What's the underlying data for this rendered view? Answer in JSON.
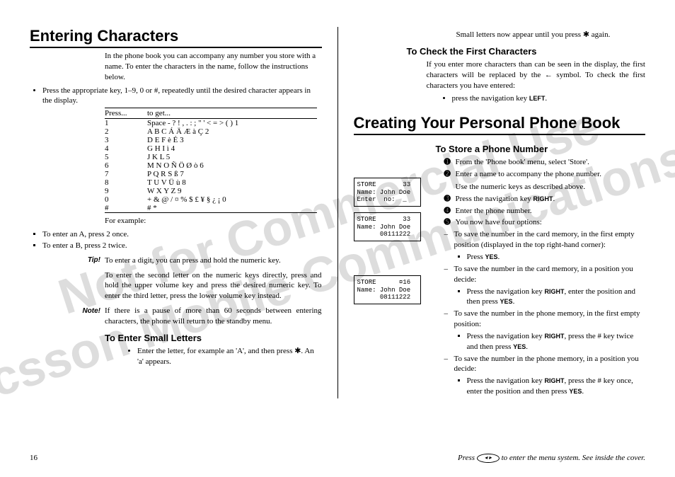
{
  "wm_l1": "Not for Commercial Use",
  "wm_l2": "Ericsson Mobile Communications AB",
  "left": {
    "h1": "Entering Characters",
    "intro": "In the phone book you can accompany any number you store with a name. To enter the characters in the name, follow the instructions below.",
    "bul1": "Press the appropriate key, 1–9, 0 or #, repeatedly until the desired character appears in the display.",
    "th1": "Press...",
    "th2": "to get...",
    "r1a": "1",
    "r1b": "Space  - ? ! , . : ; \" '  < = > ( ) 1",
    "r2a": "2",
    "r2b": "A  B  C  Á  Ä  Æ  à  Ç  2",
    "r3a": "3",
    "r3b": "D  E  F  è  É  3",
    "r4a": "4",
    "r4b": "G  H  I  ì  4",
    "r5a": "5",
    "r5b": "J  K  L  5",
    "r6a": "6",
    "r6b": "M  N  O  Ñ  Ö  Ø  ò  6",
    "r7a": "7",
    "r7b": "P  Q  R  S  ß  7",
    "r8a": "8",
    "r8b": "T  U  V  Ü  ù  8",
    "r9a": "9",
    "r9b": "W  X  Y  Z  9",
    "r10a": "0",
    "r10b": "+  &  @  /  ¤ % $  £  ¥ § ¿ ¡ 0",
    "r11a": "#",
    "r11b": "#  *",
    "forex": "For example:",
    "ex1": "To enter an A, press 2 once.",
    "ex2": "To enter a B, press 2 twice.",
    "tiplabel": "Tip!",
    "tipbody": "To enter a digit, you can press and hold the numeric key.",
    "para2": "To enter the second letter  on the numeric keys directly, press and hold the upper volume key and press the desired numeric key. To enter the third letter, press the lower volume key instead.",
    "notelabel": "Note!",
    "notebody": "If there is a pause of more than 60 seconds between entering characters, the phone will return to the standby menu.",
    "h2small": "To Enter Small Letters",
    "small1": "Enter the letter, for example an 'A', and then press ✱. An 'a' appears."
  },
  "right": {
    "topline": "Small letters now appear until you press ✱ again.",
    "h2check": "To Check the First Characters",
    "checkbody": "If you enter more characters than can be seen in the display, the first characters will be replaced by the ← symbol. To check the first characters you have entered:",
    "checkbul_pre": "press the navigation key ",
    "checkbul_key": "LEFT",
    "checkbul_post": ".",
    "h1": "Creating Your Personal Phone Book",
    "h2store": "To Store a Phone Number",
    "s1": "From the 'Phone book' menu, select 'Store'.",
    "s2": "Enter a name to accompany the phone number.",
    "s2b": "Use the numeric keys as described above.",
    "s3_pre": "Press the navigation key ",
    "s3_key": "RIGHT",
    "s3_post": ".",
    "s4": "Enter the phone number.",
    "s5": "You now have four options:",
    "d1": "To save the number in the card memory, in the first empty position (displayed in the top right-hand corner):",
    "d1a_pre": "Press ",
    "d1a_key": "YES",
    "d1a_post": ".",
    "d2": "To save the number in the card memory, in a position you decide:",
    "d2a_pre": "Press the navigation key ",
    "d2a_key": "RIGHT",
    "d2a_mid": ", enter the position and then press ",
    "d2a_key2": "YES",
    "d2a_post": ".",
    "d3": "To save the number in the phone memory, in the first empty position:",
    "d3a_pre": "Press the navigation key ",
    "d3a_key": "RIGHT",
    "d3a_mid": ", press the # key twice and then press ",
    "d3a_key2": "YES",
    "d3a_post": ".",
    "d4": "To save the number in the phone memory, in a position you decide:",
    "d4a_pre": "Press the navigation key ",
    "d4a_key": "RIGHT",
    "d4a_mid": ", press the # key once, enter the position and then press ",
    "d4a_key2": "YES",
    "d4a_post": ".",
    "lcd1": "STORE       33\nName: John Doe\nEnter  no:  _",
    "lcd2": "STORE       33\nName: John Doe\n      08111222",
    "lcd3": "STORE      ¤16\nName: John Doe\n      08111222"
  },
  "footer": {
    "page": "16",
    "hint_pre": "Press ",
    "hint_post": " to enter the menu system. See inside the cover."
  }
}
